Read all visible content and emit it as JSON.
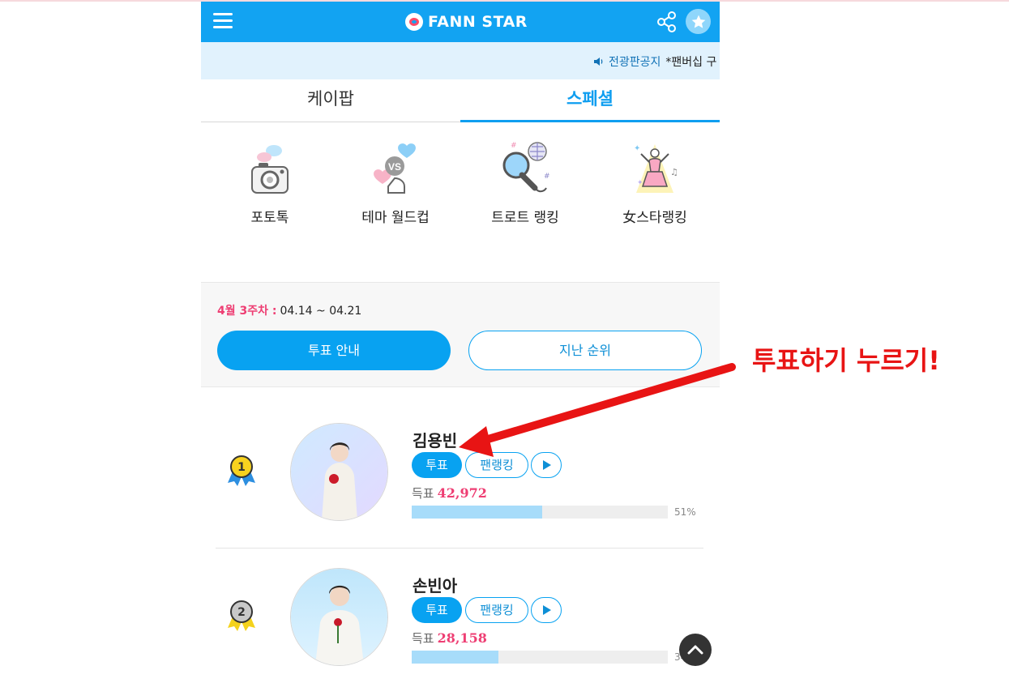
{
  "header": {
    "logo_text": "FANN STAR",
    "menu_icon": "hamburger-icon",
    "share_icon": "share-icon",
    "star_icon": "star-icon",
    "accent_color": "#12a3f2"
  },
  "notice": {
    "link_text": "전광판공지",
    "text": "*팬버십 구"
  },
  "tabs": [
    {
      "label": "케이팝",
      "active": false
    },
    {
      "label": "스페셜",
      "active": true
    }
  ],
  "categories": [
    {
      "label": "포토톡",
      "icon": "camera-icon"
    },
    {
      "label": "테마 월드컵",
      "icon": "vs-hearts-icon"
    },
    {
      "label": "트로트 랭킹",
      "icon": "microphone-icon"
    },
    {
      "label": "女스타랭킹",
      "icon": "female-star-icon"
    }
  ],
  "week": {
    "label": "4월 3주차 :",
    "range": "04.14 ~ 04.21",
    "guide_button": "투표 안내",
    "past_button": "지난 순위"
  },
  "rankings": [
    {
      "rank": 1,
      "name": "김용빈",
      "vote_label": "투표",
      "fan_ranking_label": "팬랭킹",
      "votes_label": "득표",
      "votes": "42,972",
      "percent": "51%",
      "percent_value": 0.51
    },
    {
      "rank": 2,
      "name": "손빈아",
      "vote_label": "투표",
      "fan_ranking_label": "팬랭킹",
      "votes_label": "득표",
      "votes": "28,158",
      "percent": "34%",
      "percent_value": 0.34
    }
  ],
  "annotation": {
    "text": "투표하기 누르기!",
    "color": "#e81414"
  }
}
